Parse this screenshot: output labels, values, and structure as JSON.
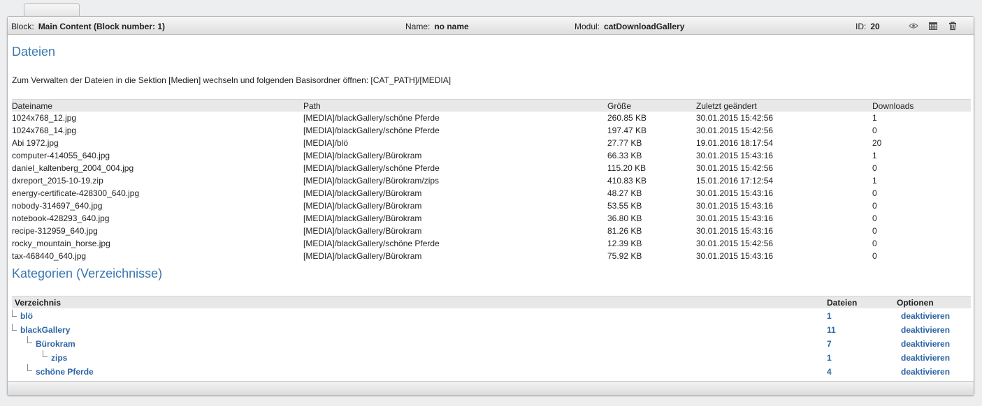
{
  "header": {
    "block_label": "Block:",
    "block_value": "Main Content (Block number: 1)",
    "name_label": "Name:",
    "name_value": "no name",
    "modul_label": "Modul:",
    "modul_value": "catDownloadGallery",
    "id_label": "ID:",
    "id_value": "20",
    "icons": [
      "eye-icon",
      "calendar-icon",
      "trash-icon"
    ]
  },
  "files": {
    "title": "Dateien",
    "info": "Zum Verwalten der Dateien in die Sektion [Medien] wechseln und folgenden Basisordner öffnen: [CAT_PATH]/[MEDIA]",
    "columns": [
      "Dateiname",
      "Path",
      "Größe",
      "Zuletzt geändert",
      "Downloads"
    ],
    "rows": [
      [
        "1024x768_12.jpg",
        "[MEDIA]/blackGallery/schöne Pferde",
        "260.85 KB",
        "30.01.2015 15:42:56",
        "1"
      ],
      [
        "1024x768_14.jpg",
        "[MEDIA]/blackGallery/schöne Pferde",
        "197.47 KB",
        "30.01.2015 15:42:56",
        "0"
      ],
      [
        "Abi 1972.jpg",
        "[MEDIA]/blö",
        "27.77 KB",
        "19.01.2016 18:17:54",
        "20"
      ],
      [
        "computer-414055_640.jpg",
        "[MEDIA]/blackGallery/Bürokram",
        "66.33 KB",
        "30.01.2015 15:43:16",
        "1"
      ],
      [
        "daniel_kaltenberg_2004_004.jpg",
        "[MEDIA]/blackGallery/schöne Pferde",
        "115.20 KB",
        "30.01.2015 15:42:56",
        "0"
      ],
      [
        "dxreport_2015-10-19.zip",
        "[MEDIA]/blackGallery/Bürokram/zips",
        "410.83 KB",
        "15.01.2016 17:12:54",
        "1"
      ],
      [
        "energy-certificate-428300_640.jpg",
        "[MEDIA]/blackGallery/Bürokram",
        "48.27 KB",
        "30.01.2015 15:43:16",
        "0"
      ],
      [
        "nobody-314697_640.jpg",
        "[MEDIA]/blackGallery/Bürokram",
        "53.55 KB",
        "30.01.2015 15:43:16",
        "0"
      ],
      [
        "notebook-428293_640.jpg",
        "[MEDIA]/blackGallery/Bürokram",
        "36.80 KB",
        "30.01.2015 15:43:16",
        "0"
      ],
      [
        "recipe-312959_640.jpg",
        "[MEDIA]/blackGallery/Bürokram",
        "81.26 KB",
        "30.01.2015 15:43:16",
        "0"
      ],
      [
        "rocky_mountain_horse.jpg",
        "[MEDIA]/blackGallery/schöne Pferde",
        "12.39 KB",
        "30.01.2015 15:42:56",
        "0"
      ],
      [
        "tax-468440_640.jpg",
        "[MEDIA]/blackGallery/Bürokram",
        "75.92 KB",
        "30.01.2015 15:43:16",
        "0"
      ]
    ]
  },
  "categories": {
    "title": "Kategorien (Verzeichnisse)",
    "columns": [
      "Verzeichnis",
      "Dateien",
      "Optionen"
    ],
    "rows": [
      {
        "name": "blö",
        "depth": 0,
        "files": "1",
        "option": "deaktivieren"
      },
      {
        "name": "blackGallery",
        "depth": 0,
        "files": "11",
        "option": "deaktivieren"
      },
      {
        "name": "Bürokram",
        "depth": 1,
        "files": "7",
        "option": "deaktivieren"
      },
      {
        "name": "zips",
        "depth": 2,
        "files": "1",
        "option": "deaktivieren"
      },
      {
        "name": "schöne Pferde",
        "depth": 1,
        "files": "4",
        "option": "deaktivieren"
      }
    ]
  }
}
